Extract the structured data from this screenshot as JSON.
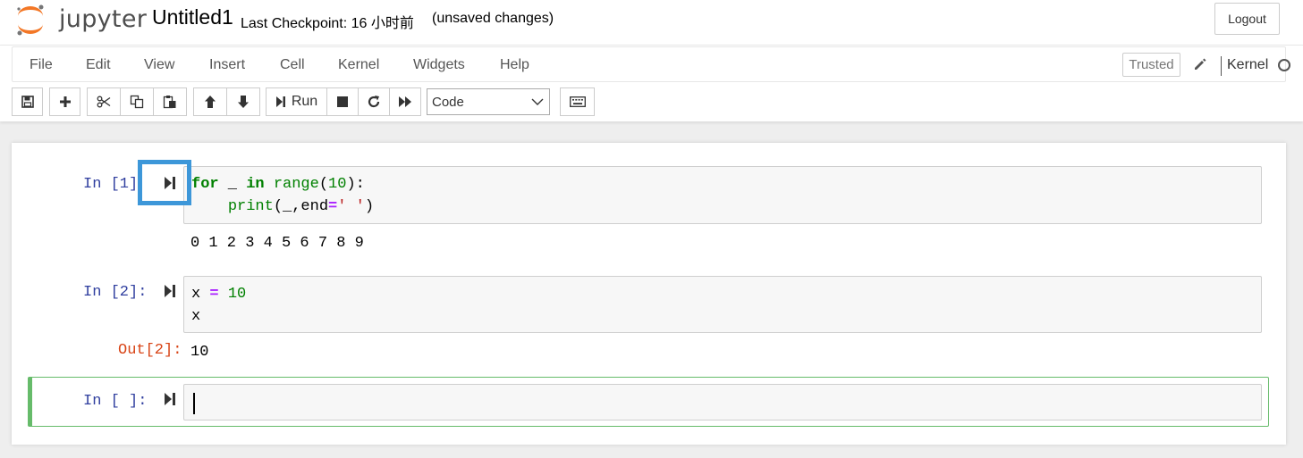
{
  "header": {
    "logo_text": "jupyter",
    "notebook_title": "Untitled1",
    "checkpoint": "Last Checkpoint: 16 小时前",
    "autosave_status": "(unsaved changes)",
    "logout_label": "Logout"
  },
  "menubar": {
    "items": [
      "File",
      "Edit",
      "View",
      "Insert",
      "Cell",
      "Kernel",
      "Widgets",
      "Help"
    ],
    "trusted_label": "Trusted",
    "kernel_name": "Kernel"
  },
  "toolbar": {
    "run_label": "Run",
    "cell_type": "Code",
    "buttons": [
      "save-icon",
      "plus-icon",
      "cut-icon",
      "copy-icon",
      "paste-icon",
      "arrow-up-icon",
      "arrow-down-icon",
      "step-forward-icon",
      "stop-icon",
      "refresh-icon",
      "fast-forward-icon",
      "keyboard-icon"
    ]
  },
  "cells": [
    {
      "prompt": "In [1]",
      "code_lines": [
        "for _ in range(10):",
        "    print(_,end=' ')"
      ],
      "output": "0 1 2 3 4 5 6 7 8 9"
    },
    {
      "prompt": "In [2]:",
      "code_lines": [
        "x = 10",
        "x"
      ],
      "out_prompt": "Out[2]:",
      "output": "10"
    },
    {
      "prompt": "In [ ]:",
      "code_lines": [
        ""
      ]
    }
  ],
  "colors": {
    "prompt_in": "#303f9f",
    "prompt_out": "#d84315",
    "selected_border": "#66bb6a",
    "highlight": "#3d97d9",
    "keyword": "#008000",
    "operator": "#aa22ff",
    "string": "#ba2121"
  }
}
